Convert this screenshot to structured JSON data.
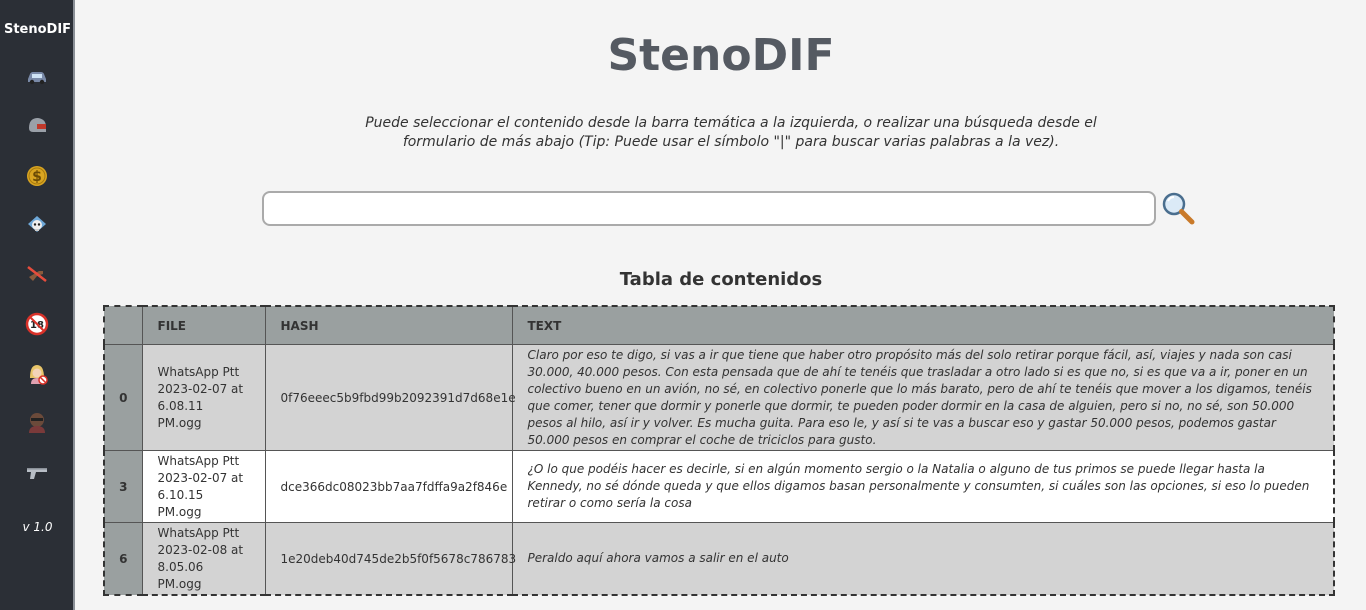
{
  "sidebar": {
    "brand": "StenoDIF",
    "items": [
      {
        "icon": "car-icon"
      },
      {
        "icon": "motorcycle-helmet-icon"
      },
      {
        "icon": "money-icon"
      },
      {
        "icon": "skull-bomb-icon"
      },
      {
        "icon": "no-weapons-icon"
      },
      {
        "icon": "adults-only-18-icon"
      },
      {
        "icon": "no-women-icon"
      },
      {
        "icon": "masked-person-icon"
      },
      {
        "icon": "gun-icon"
      }
    ],
    "version": "v 1.0"
  },
  "header": {
    "title": "StenoDIF",
    "intro": "Puede seleccionar el contenido desde la barra temática a la izquierda, o realizar una búsqueda desde el formulario de más abajo (Tip: Puede usar el símbolo \"|\" para buscar varias palabras a la vez)."
  },
  "search": {
    "value": "",
    "placeholder": ""
  },
  "table": {
    "title": "Tabla de contenidos",
    "columns": [
      "",
      "FILE",
      "HASH",
      "TEXT"
    ],
    "rows": [
      {
        "index": "0",
        "file_line1": "WhatsApp Ptt",
        "file_line2": "2023-02-07 at",
        "file_line3": "6.08.11 PM.ogg",
        "hash": "0f76eeec5b9fbd99b2092391d7d68e1e",
        "text": "Claro por eso te digo, si vas a ir que tiene que haber otro propósito más del solo retirar porque fácil, así, viajes y nada son casi 30.000, 40.000 pesos. Con esta pensada que de ahí te tenéis que trasladar a otro lado si es que no, si es que va a ir, poner en un colectivo bueno en un avión, no sé, en colectivo ponerle que lo más barato, pero de ahí te tenéis que mover a los digamos, tenéis que comer, tener que dormir y ponerle que dormir, te pueden poder dormir en la casa de alguien, pero si no, no sé, son 50.000 pesos al hilo, así ir y volver. Es mucha guita. Para eso le, y así si te vas a buscar eso y gastar 50.000 pesos, podemos gastar 50.000 pesos en comprar el coche de triciclos para gusto."
      },
      {
        "index": "3",
        "file_line1": "WhatsApp Ptt",
        "file_line2": "2023-02-07 at",
        "file_line3": "6.10.15 PM.ogg",
        "hash": "dce366dc08023bb7aa7fdffa9a2f846e",
        "text": "¿O lo que podéis hacer es decirle, si en algún momento sergio o la Natalia o alguno de tus primos se puede llegar hasta la Kennedy, no sé dónde queda y que ellos digamos basan personalmente y consumten, si cuáles son las opciones, si eso lo pueden retirar o como sería la cosa"
      },
      {
        "index": "6",
        "file_line1": "WhatsApp Ptt",
        "file_line2": "2023-02-08 at",
        "file_line3": "8.05.06 PM.ogg",
        "hash": "1e20deb40d745de2b5f0f5678c786783",
        "text": "Peraldo aquí ahora vamos a salir en el auto"
      }
    ]
  }
}
